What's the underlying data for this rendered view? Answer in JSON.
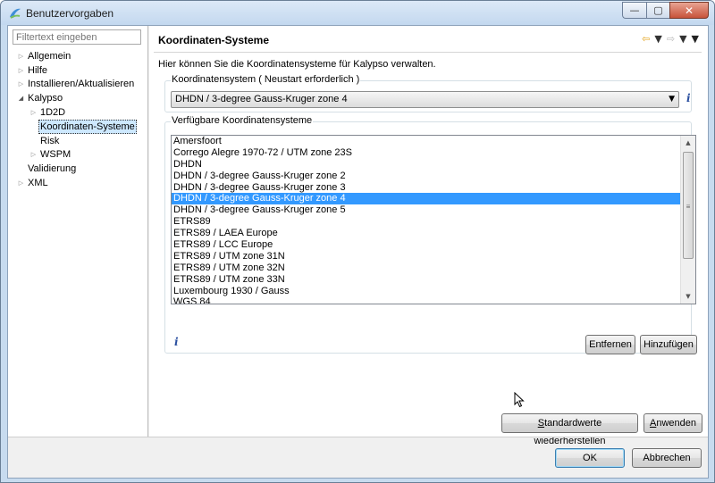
{
  "window": {
    "title": "Benutzervorgaben",
    "close_glyph": "✕",
    "max_glyph": "▢",
    "min_glyph": "—"
  },
  "filter": {
    "placeholder": "Filtertext eingeben"
  },
  "tree": [
    {
      "label": "Allgemein",
      "indent": 0,
      "twisty": "collapsed",
      "selected": false
    },
    {
      "label": "Hilfe",
      "indent": 0,
      "twisty": "collapsed",
      "selected": false
    },
    {
      "label": "Installieren/Aktualisieren",
      "indent": 0,
      "twisty": "collapsed",
      "selected": false
    },
    {
      "label": "Kalypso",
      "indent": 0,
      "twisty": "expanded",
      "selected": false
    },
    {
      "label": "1D2D",
      "indent": 1,
      "twisty": "collapsed",
      "selected": false
    },
    {
      "label": "Koordinaten-Systeme",
      "indent": 1,
      "twisty": "none",
      "selected": true
    },
    {
      "label": "Risk",
      "indent": 1,
      "twisty": "none",
      "selected": false
    },
    {
      "label": "WSPM",
      "indent": 1,
      "twisty": "collapsed",
      "selected": false
    },
    {
      "label": "Validierung",
      "indent": 0,
      "twisty": "none",
      "selected": false
    },
    {
      "label": "XML",
      "indent": 0,
      "twisty": "collapsed",
      "selected": false
    }
  ],
  "page": {
    "title": "Koordinaten-Systeme",
    "description": "Hier können Sie die Koordinatensysteme für Kalypso verwalten.",
    "nav_icons": [
      "back-arrow-icon",
      "forward-arrow-icon",
      "view-menu-icon"
    ]
  },
  "coord_group": {
    "label": "Koordinatensystem ( Neustart erforderlich )",
    "selected_value": "DHDN / 3-degree Gauss-Kruger zone 4"
  },
  "available_group": {
    "label": "Verfügbare Koordinatensysteme",
    "items": [
      "Amersfoort",
      "Corrego Alegre 1970-72 / UTM zone 23S",
      "DHDN",
      "DHDN / 3-degree Gauss-Kruger zone 2",
      "DHDN / 3-degree Gauss-Kruger zone 3",
      "DHDN / 3-degree Gauss-Kruger zone 4",
      "DHDN / 3-degree Gauss-Kruger zone 5",
      "ETRS89",
      "ETRS89 / LAEA Europe",
      "ETRS89 / LCC Europe",
      "ETRS89 / UTM zone 31N",
      "ETRS89 / UTM zone 32N",
      "ETRS89 / UTM zone 33N",
      "Luxembourg 1930 / Gauss",
      "WGS 84"
    ],
    "selected_index": 5,
    "remove_label": "Entfernen",
    "add_label": "Hinzufügen"
  },
  "page_buttons": {
    "restore_defaults": "Standardwerte wiederherstellen",
    "restore_defaults_accel": "S",
    "apply": "Anwenden",
    "apply_accel": "A"
  },
  "dialog_buttons": {
    "ok": "OK",
    "cancel": "Abbrechen"
  },
  "colors": {
    "selection": "#3399ff",
    "titlebar": "#c7dbef",
    "close": "#c7533a",
    "info": "#2a4f9f"
  }
}
